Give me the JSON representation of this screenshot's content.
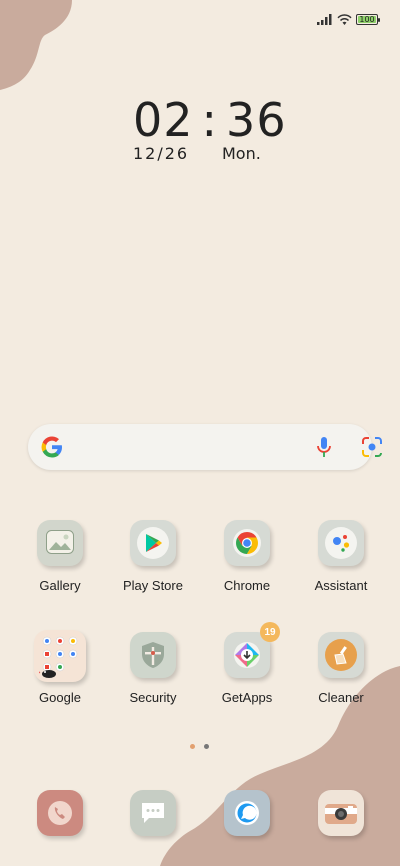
{
  "status_bar": {
    "signal_icon": "signal-bars-icon",
    "wifi_icon": "wifi-icon",
    "battery_level": "100",
    "battery_color": "#8ed16a"
  },
  "clock": {
    "hours": "02",
    "minutes": "36",
    "separator": ":",
    "date": "12/26",
    "day": "Mon."
  },
  "search_bar": {
    "logo_icon": "google-g-icon",
    "mic_icon": "microphone-icon",
    "lens_icon": "google-lens-icon"
  },
  "apps_row1": [
    {
      "label": "Gallery",
      "icon": "gallery-icon"
    },
    {
      "label": "Play Store",
      "icon": "play-store-icon"
    },
    {
      "label": "Chrome",
      "icon": "chrome-icon"
    },
    {
      "label": "Assistant",
      "icon": "assistant-icon"
    }
  ],
  "apps_row2": [
    {
      "label": "Google",
      "icon": "google-folder-icon"
    },
    {
      "label": "Security",
      "icon": "security-icon"
    },
    {
      "label": "GetApps",
      "icon": "getapps-icon",
      "badge": "19"
    },
    {
      "label": "Cleaner",
      "icon": "cleaner-icon"
    }
  ],
  "page_indicator": {
    "pages": 2,
    "active": 1,
    "active_color": "#e2a070",
    "inactive_color": "#777777"
  },
  "dock": [
    {
      "icon": "phone-icon"
    },
    {
      "icon": "messages-icon"
    },
    {
      "icon": "browser-icon"
    },
    {
      "icon": "camera-icon"
    }
  ],
  "colors": {
    "wallpaper": "#f3ebe0",
    "blob": "#c9ab9d",
    "tile": "#d6dad2"
  }
}
